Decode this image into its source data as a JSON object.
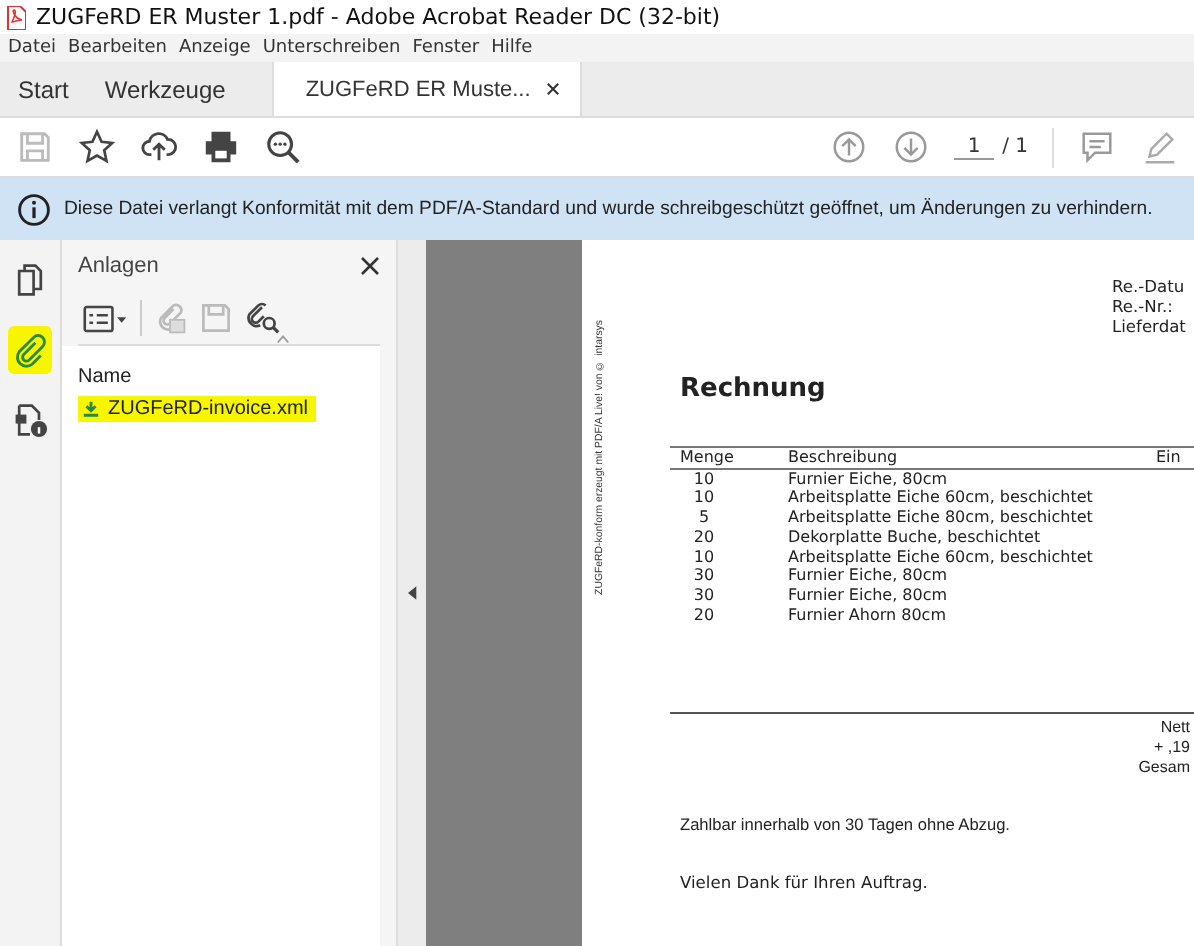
{
  "window": {
    "title": "ZUGFeRD ER Muster 1.pdf - Adobe Acrobat Reader DC (32-bit)"
  },
  "menu": [
    "Datei",
    "Bearbeiten",
    "Anzeige",
    "Unterschreiben",
    "Fenster",
    "Hilfe"
  ],
  "tabs": [
    {
      "label": "Start",
      "selected": false,
      "closable": false
    },
    {
      "label": "Werkzeuge",
      "selected": false,
      "closable": false
    },
    {
      "label": "ZUGFeRD ER Muste...",
      "selected": true,
      "closable": true
    }
  ],
  "toolbar": {
    "page": "1",
    "page_total": "/ 1"
  },
  "info_bar": {
    "text": "Diese Datei verlangt Konformität mit dem PDF/A-Standard und wurde schreibgeschützt geöffnet, um Änderungen zu verhindern."
  },
  "rail": [
    {
      "kind": "pages",
      "highlighted": false
    },
    {
      "kind": "attachments",
      "highlighted": true
    },
    {
      "kind": "security",
      "highlighted": false
    }
  ],
  "panel": {
    "title": "Anlagen",
    "column": "Name",
    "items": [
      {
        "name": "ZUGFeRD-invoice.xml",
        "highlighted": true
      }
    ]
  },
  "document": {
    "side_note": "ZUGFeRD-konform erzeugt mit PDF/A Live! von © intarsys",
    "meta": [
      "Re.-Datu",
      "Re.-Nr.:",
      "Lieferdat"
    ],
    "heading": "Rechnung",
    "columns": [
      "Menge",
      "Beschreibung",
      "Ein"
    ],
    "rows": [
      [
        "10",
        "Furnier Eiche, 80cm"
      ],
      [
        "10",
        "Arbeitsplatte Eiche 60cm, beschichtet"
      ],
      [
        "5",
        "Arbeitsplatte Eiche 80cm, beschichtet"
      ],
      [
        "20",
        "Dekorplatte Buche, beschichtet"
      ],
      [
        "10",
        "Arbeitsplatte Eiche 60cm, beschichtet"
      ],
      [
        "30",
        "Furnier Eiche, 80cm"
      ],
      [
        "30",
        "Furnier Eiche, 80cm"
      ],
      [
        "20",
        "Furnier Ahorn 80cm"
      ]
    ],
    "totals": [
      "Nett",
      "+ ,19",
      "Gesam"
    ],
    "terms": "Zahlbar innerhalb von 30 Tagen ohne Abzug.",
    "thanks": "Vielen Dank für Ihren Auftrag."
  }
}
